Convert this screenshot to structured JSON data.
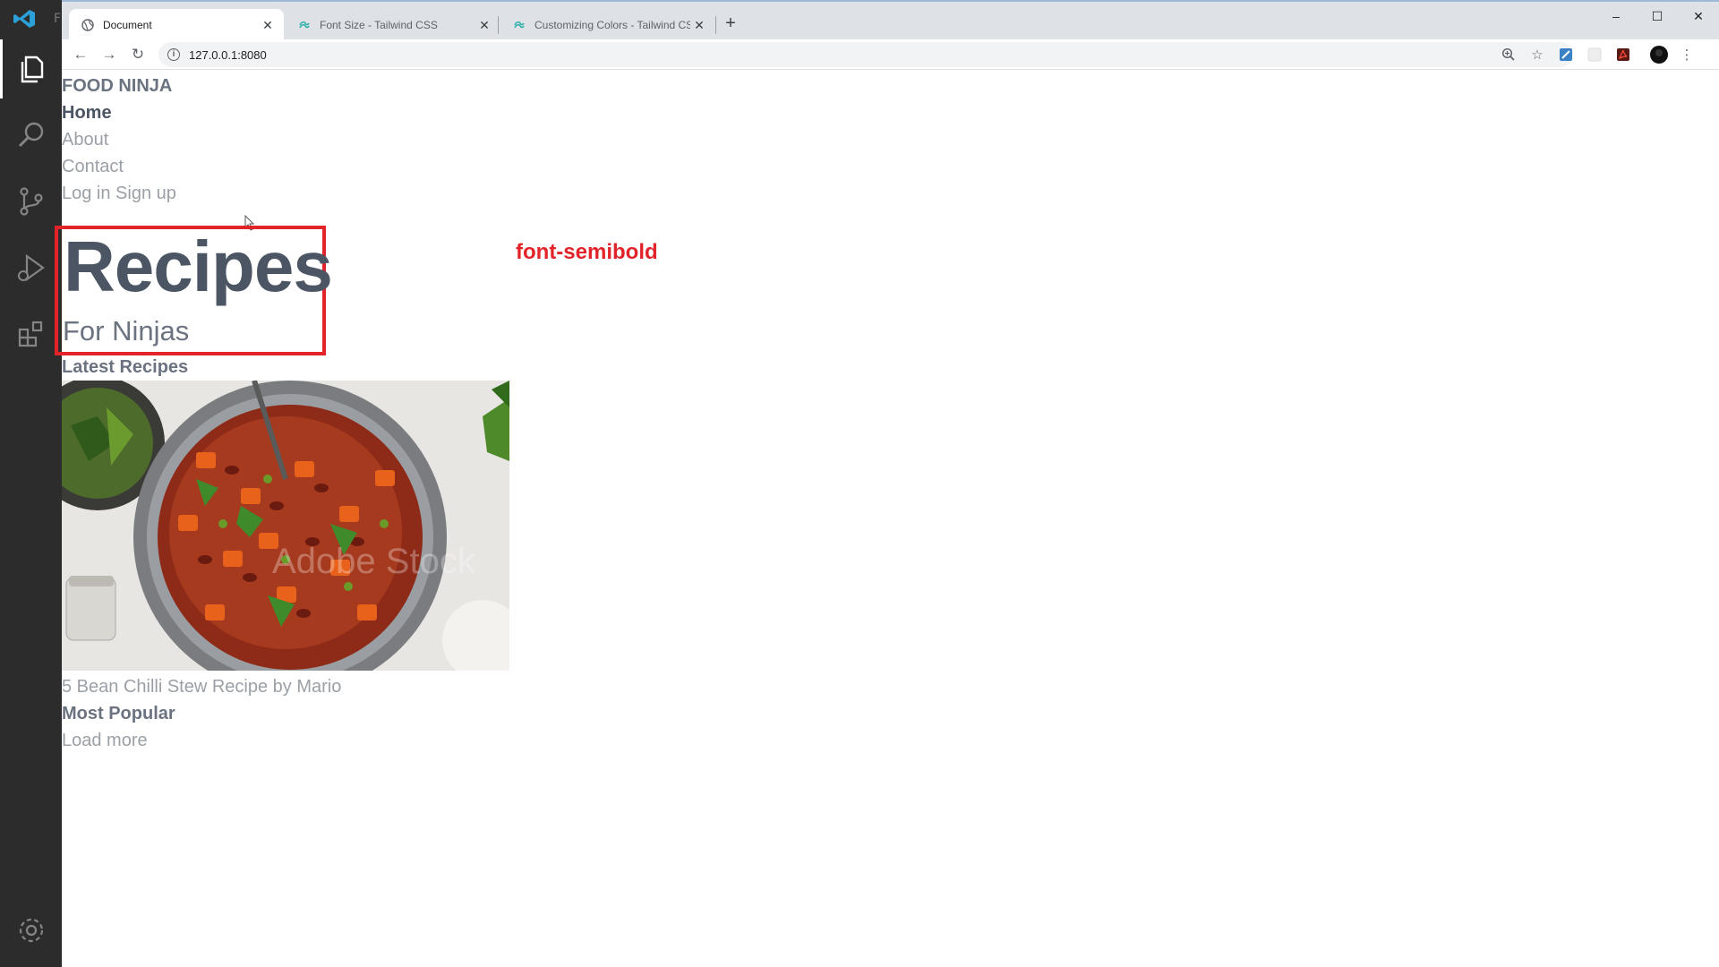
{
  "vscode": {
    "letter": "F",
    "icons": [
      "explorer-icon",
      "search-icon",
      "source-control-icon",
      "run-debug-icon",
      "extensions-icon",
      "settings-gear-icon"
    ]
  },
  "browser": {
    "tabs": [
      {
        "title": "Document",
        "icon": "globe-icon",
        "active": true
      },
      {
        "title": "Font Size - Tailwind CSS",
        "icon": "tailwind-icon",
        "active": false
      },
      {
        "title": "Customizing Colors - Tailwind CSS",
        "icon": "tailwind-icon",
        "active": false
      }
    ],
    "new_tab": "+",
    "window_controls": {
      "minimize": "–",
      "maximize": "☐",
      "close": "✕"
    },
    "nav": {
      "back": "←",
      "forward": "→",
      "reload": "↻"
    },
    "url": "127.0.0.1:8080",
    "info_icon": "i",
    "toolbar_icons": [
      "zoom-icon",
      "star-icon",
      "extension-icon",
      "extension-blank-icon",
      "pdf-icon",
      "profile-icon",
      "menu-icon"
    ]
  },
  "page": {
    "brand": "FOOD NINJA",
    "nav": [
      "Home",
      "About",
      "Contact",
      "Log in Sign up"
    ],
    "hero": {
      "title": "Recipes",
      "subtitle": "For Ninjas"
    },
    "annotation": "font-semibold",
    "latest_heading": "Latest Recipes",
    "recipe": {
      "watermark": "Adobe Stock",
      "caption": "5 Bean Chilli Stew Recipe by Mario"
    },
    "popular_heading": "Most Popular",
    "load_more": "Load more",
    "colors": {
      "annotation_red": "#e2242a",
      "heading_gray": "#4b5563"
    }
  }
}
